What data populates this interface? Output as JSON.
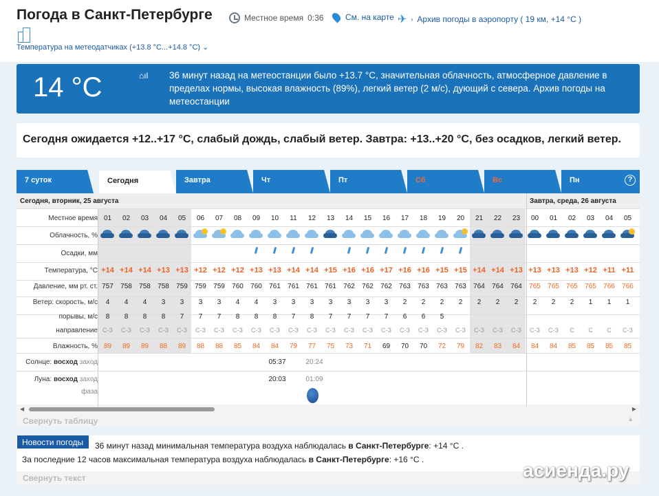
{
  "header": {
    "title": "Погода в Санкт-Петербурге",
    "local_time_label": "Местное время",
    "local_time": "0:36",
    "map_link": "См. на карте",
    "archive_link": "Архив погоды в аэропорту ( 19 км, +14 °C )",
    "sensors": "Температура на метеодатчиках (+13.8 °C...+14.8 °C)"
  },
  "now": {
    "temp": "14 °C",
    "desc": "36 минут назад на метеостанции было +13.7 °C, значительная облачность, атмосферное давление в пределах нормы, высокая влажность (89%), легкий ветер (2 м/с), дующий с севера. Архив погоды на метеостанции"
  },
  "expect": "Сегодня ожидается +12..+17 °C, слабый дождь, слабый ветер. Завтра: +13..+20 °C, без осадков, легкий ветер.",
  "tabs": [
    "7 суток",
    "Сегодня",
    "Завтра",
    "Чт",
    "Пт",
    "Сб",
    "Вс",
    "Пн"
  ],
  "help": "?",
  "table": {
    "day1": "Сегодня, вторник, 25 августа",
    "day2": "Завтра, среда, 26 августа",
    "labels": {
      "time": "Местное время",
      "cloud": "Облачность, %",
      "precip": "Осадки, мм",
      "temp": "Температура, °C",
      "pressure": "Давление, мм рт. ст.",
      "wind_bold": "Ветер:",
      "wind": " скорость, м/с",
      "gusts": "порывы, м/с",
      "dir": "направление",
      "hum": "Влажность, %",
      "sun_pre": "Солнце: ",
      "sun_b": "восход",
      "sun_post": " заход",
      "moon_pre": "Луна: ",
      "moon_b": "восход",
      "moon_post": " заход",
      "phase": "фаза"
    },
    "hours": [
      "01",
      "02",
      "03",
      "04",
      "05",
      "06",
      "07",
      "08",
      "09",
      "10",
      "11",
      "12",
      "13",
      "14",
      "15",
      "16",
      "17",
      "18",
      "19",
      "20",
      "21",
      "22",
      "23",
      "00",
      "01",
      "02",
      "03",
      "04",
      "05"
    ],
    "temps": [
      "+14",
      "+14",
      "+14",
      "+13",
      "+13",
      "+12",
      "+12",
      "+12",
      "+13",
      "+13",
      "+14",
      "+14",
      "+15",
      "+16",
      "+16",
      "+17",
      "+16",
      "+16",
      "+15",
      "+15",
      "+14",
      "+14",
      "+13",
      "+13",
      "+13",
      "+13",
      "+12",
      "+11",
      "+11"
    ],
    "pressure": [
      "757",
      "758",
      "758",
      "758",
      "759",
      "759",
      "759",
      "760",
      "760",
      "761",
      "761",
      "761",
      "761",
      "762",
      "762",
      "762",
      "763",
      "763",
      "763",
      "763",
      "764",
      "764",
      "764",
      "765",
      "765",
      "765",
      "765",
      "766",
      "766"
    ],
    "wind": [
      "4",
      "4",
      "4",
      "3",
      "3",
      "3",
      "3",
      "4",
      "4",
      "3",
      "3",
      "3",
      "3",
      "3",
      "3",
      "3",
      "2",
      "2",
      "2",
      "2",
      "2",
      "2",
      "2",
      "2",
      "2",
      "2",
      "1",
      "1",
      "1"
    ],
    "gusts": [
      "8",
      "8",
      "8",
      "8",
      "7",
      "7",
      "7",
      "8",
      "8",
      "8",
      "7",
      "8",
      "7",
      "7",
      "7",
      "7",
      "6",
      "6",
      "5",
      "",
      "",
      "",
      "",
      "",
      "",
      "",
      "",
      "",
      ""
    ],
    "dir": [
      "С-З",
      "С-З",
      "С-З",
      "С-З",
      "С-З",
      "С-З",
      "С-З",
      "С-З",
      "С-З",
      "С-З",
      "С-З",
      "С-З",
      "С-З",
      "С-З",
      "С-З",
      "С-З",
      "С-З",
      "С-З",
      "С-З",
      "С-З",
      "С-З",
      "С-З",
      "С-З",
      "С-З",
      "С-З",
      "С",
      "С",
      "С",
      "С-З"
    ],
    "hum": [
      "89",
      "89",
      "89",
      "88",
      "89",
      "88",
      "88",
      "85",
      "84",
      "84",
      "79",
      "77",
      "75",
      "73",
      "71",
      "69",
      "70",
      "70",
      "72",
      "79",
      "82",
      "83",
      "84",
      "84",
      "84",
      "85",
      "85",
      "85",
      "85"
    ],
    "sunrise": "05:37",
    "sunset": "20:24",
    "moonrise": "20:03",
    "moonset": "01:09",
    "collapse": "Свернуть таблицу"
  },
  "news": {
    "button": "Новости погоды",
    "line1_pre": "36 минут назад минимальная температура воздуха наблюдалась ",
    "line1_b": "в Санкт-Петербурге",
    "line1_post": ": +14 °C .",
    "line2_pre": "За последние 12 часов максимальная температура воздуха наблюдалась ",
    "line2_b": "в Санкт-Петербурге",
    "line2_post": ": +16 °C .",
    "collapse": "Свернуть текст"
  },
  "watermark": "асиенда.ру",
  "colors": {
    "accent": "#1e7cc8",
    "orange": "#f06020"
  }
}
